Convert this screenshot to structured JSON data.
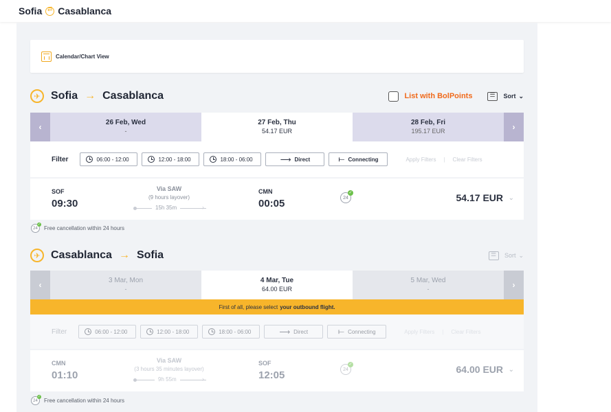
{
  "header": {
    "origin": "Sofia",
    "destination": "Casablanca",
    "swap_icon": "swap-circle-icon"
  },
  "calendar_view": {
    "label": "Calendar/Chart View",
    "icon": "calendar-chart-icon"
  },
  "outbound": {
    "from": "Sofia",
    "to": "Casablanca",
    "list_with_points": "List with BolPoints",
    "sort_label": "Sort",
    "dates": [
      {
        "date": "26 Feb, Wed",
        "price": "-"
      },
      {
        "date": "27 Feb, Thu",
        "price": "54.17 EUR"
      },
      {
        "date": "28 Feb, Fri",
        "price": "195.17 EUR"
      }
    ],
    "filters": {
      "label": "Filter",
      "times": [
        "06:00 - 12:00",
        "12:00 - 18:00",
        "18:00 - 06:00"
      ],
      "direct": "Direct",
      "connecting": "Connecting",
      "apply": "Apply Filters",
      "separator": "|",
      "clear": "Clear Filters"
    },
    "flight": {
      "dep_code": "SOF",
      "dep_time": "09:30",
      "via": "Via SAW",
      "layover": "(9 hours layover)",
      "duration": "15h 35m",
      "arr_code": "CMN",
      "arr_time": "00:05",
      "badge": "24",
      "price": "54.17 EUR"
    },
    "free_cancellation": "Free cancellation within 24 hours"
  },
  "return": {
    "from": "Casablanca",
    "to": "Sofia",
    "sort_label": "Sort",
    "dates": [
      {
        "date": "3 Mar, Mon",
        "price": "-"
      },
      {
        "date": "4 Mar, Tue",
        "price": "64.00 EUR"
      },
      {
        "date": "5 Mar, Wed",
        "price": "-"
      }
    ],
    "notice_prefix": "First of all, please select",
    "notice_bold": "your outbound flight.",
    "filters": {
      "label": "Filter",
      "times": [
        "06:00 - 12:00",
        "12:00 - 18:00",
        "18:00 - 06:00"
      ],
      "direct": "Direct",
      "connecting": "Connecting",
      "apply": "Apply Filters",
      "separator": "|",
      "clear": "Clear Filters"
    },
    "flight": {
      "dep_code": "CMN",
      "dep_time": "01:10",
      "via": "Via SAW",
      "layover": "(3 hours 35 minutes layover)",
      "duration": "9h 55m",
      "arr_code": "SOF",
      "arr_time": "12:05",
      "badge": "24",
      "price": "64.00 EUR"
    },
    "free_cancellation": "Free cancellation within 24 hours"
  },
  "colors": {
    "accent": "#f7b52b",
    "points_link": "#f06a1b",
    "outbound_nav": "#b8b4d0",
    "check_badge": "#6cc04a"
  }
}
